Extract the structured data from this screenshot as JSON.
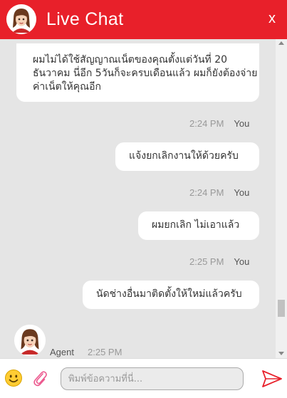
{
  "header": {
    "title": "Live Chat",
    "close_label": "x",
    "avatar_icon": "agent-avatar-icon"
  },
  "messages": [
    {
      "text": "ผมไม่ได้ใช้สัญญาณเน็ตของคุณตั้งแต่วันที่ 20 ธันวาคม นี่อีก 5วันก็จะครบเดือนแล้ว ผมก็ยังต้องจ่ายค่าเน็ตให้คุณอีก"
    },
    {
      "time": "2:24 PM",
      "sender": "You",
      "text": "แจ้งยกเลิกงานให้ด้วยครับ"
    },
    {
      "time": "2:24 PM",
      "sender": "You",
      "text": "ผมยกเลิก ไม่เอาแล้ว"
    },
    {
      "time": "2:25 PM",
      "sender": "You",
      "text": "นัดช่างอื่นมาติดตั้งให้ใหม่แล้วครับ"
    }
  ],
  "agent": {
    "name": "Agent",
    "time": "2:25 PM"
  },
  "input": {
    "placeholder": "พิมพ์ข้อความที่นี่..."
  },
  "colors": {
    "brand": "#e8202a",
    "chat_background": "#e5e5e5",
    "bubble": "#ffffff"
  },
  "icons": {
    "emoji": "smiley-icon",
    "attach": "paperclip-icon",
    "send": "send-icon"
  }
}
